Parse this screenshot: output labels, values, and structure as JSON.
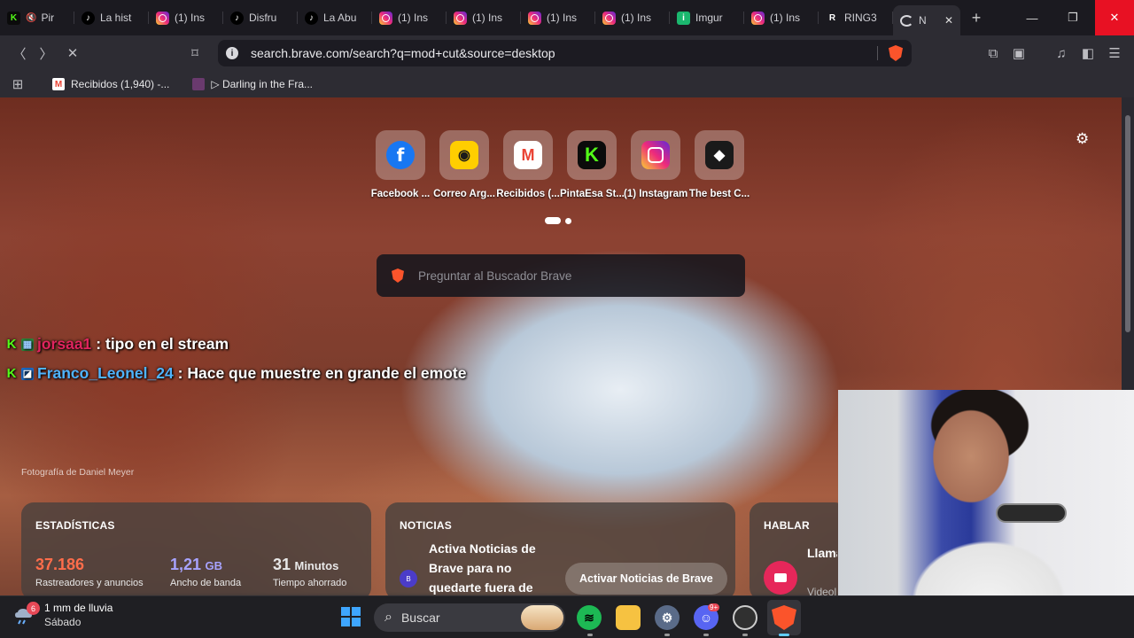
{
  "tabs": [
    {
      "icon": "kick-icon",
      "label": "Pir",
      "muted": true
    },
    {
      "icon": "tiktok-icon",
      "label": "La hist"
    },
    {
      "icon": "instagram-icon",
      "label": "(1) Ins"
    },
    {
      "icon": "tiktok-icon",
      "label": "Disfru"
    },
    {
      "icon": "tiktok-icon",
      "label": "La Abu"
    },
    {
      "icon": "instagram-icon",
      "label": "(1) Ins"
    },
    {
      "icon": "instagram-icon",
      "label": "(1) Ins"
    },
    {
      "icon": "instagram-icon",
      "label": "(1) Ins"
    },
    {
      "icon": "instagram-icon",
      "label": "(1) Ins"
    },
    {
      "icon": "imgur-icon",
      "label": "Imgur"
    },
    {
      "icon": "instagram-icon",
      "label": "(1) Ins"
    },
    {
      "icon": "ring-icon",
      "label": "RING3"
    },
    {
      "icon": "loading-icon",
      "label": "N",
      "active": true
    }
  ],
  "address_bar": {
    "url": "search.brave.com/search?q=mod+cut&source=desktop"
  },
  "bookmarks": [
    {
      "icon": "gmail-icon",
      "label": "Recibidos (1,940) -..."
    },
    {
      "icon": "video-thumb-icon",
      "label": "▷ Darling in the Fra..."
    }
  ],
  "top_sites": [
    {
      "icon": "facebook-icon",
      "label": "Facebook ..."
    },
    {
      "icon": "correo-argentino-icon",
      "label": "Correo Arg..."
    },
    {
      "icon": "gmail-icon",
      "label": "Recibidos (..."
    },
    {
      "icon": "kick-icon",
      "label": "PintaEsa St..."
    },
    {
      "icon": "instagram-icon",
      "label": "(1) Instagram"
    },
    {
      "icon": "game-icon",
      "label": "The best C..."
    }
  ],
  "search": {
    "placeholder": "Preguntar al Buscador Brave"
  },
  "chat": [
    {
      "user": "jorsaa1",
      "message": ": tipo en el stream",
      "user_color": "#e0245e"
    },
    {
      "user": "Franco_Leonel_24",
      "message": ": Hace que muestre en grande el emote",
      "user_color": "#4fb4ff"
    }
  ],
  "photo_credit": "Fotografía de Daniel Meyer",
  "stats": {
    "title": "ESTADÍSTICAS",
    "items": [
      {
        "value": "37.186",
        "unit": "",
        "caption": "Rastreadores y anuncios",
        "color": "#ff6d4b"
      },
      {
        "value": "1,21",
        "unit": "GB",
        "caption": "Ancho de banda",
        "color": "#a7a3ff"
      },
      {
        "value": "31",
        "unit": "Minutos",
        "caption": "Tiempo ahorrado",
        "color": "#ffffff"
      }
    ]
  },
  "news": {
    "title": "NOTICIAS",
    "text": "Activa Noticias de Brave para no quedarte fuera de",
    "button": "Activar Noticias de Brave"
  },
  "talk": {
    "title": "HABLAR",
    "text": "Llama privad",
    "sub": "Videol"
  },
  "taskbar": {
    "weather_badge": "6",
    "weather": "1 mm de lluvia",
    "day": "Sábado",
    "search_placeholder": "Buscar",
    "discord_badge": "9+"
  }
}
